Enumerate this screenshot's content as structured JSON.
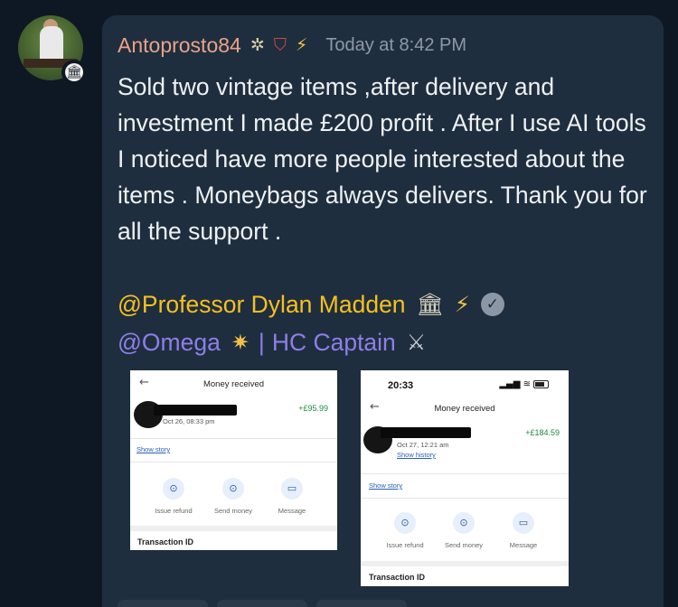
{
  "post": {
    "username": "Antoprosto84",
    "timestamp": "Today at 8:42 PM",
    "badges": [
      "pin-icon",
      "shield-icon",
      "lightning-icon"
    ],
    "message": "Sold two vintage items ,after delivery and investment I made £200 profit . After I use AI tools I noticed have more people interested about the items . Moneybags always delivers. Thank you for all the support .",
    "mentions": [
      {
        "text": "@Professor Dylan Madden",
        "icons": [
          "bank-icon",
          "lightning-icon",
          "verified-icon"
        ]
      },
      {
        "text": "@Omega",
        "icons": [
          "comet-icon"
        ],
        "suffix": "HC Captain",
        "suffix_icon": "swords-icon"
      }
    ]
  },
  "colors": {
    "background": "#0e1824",
    "bubble": "#1f2e3e",
    "username": "#e8a38a",
    "mention_gold": "#f5c022",
    "mention_purple": "#8d7fe8",
    "amount_green": "#1d8a3d"
  },
  "attachments": [
    {
      "title": "Money received",
      "amount": "+£95.99",
      "date": "Oct 26, 08:33 pm",
      "story_link": "Show story",
      "actions": [
        "Issue refund",
        "Send money",
        "Message"
      ],
      "transaction_label": "Transaction ID"
    },
    {
      "status_time": "20:33",
      "title": "Money received",
      "amount": "+£184.59",
      "date": "Oct 27, 12:21 am",
      "history_link": "Show history",
      "story_link": "Show story",
      "actions": [
        "Issue refund",
        "Send money",
        "Message"
      ],
      "transaction_label": "Transaction ID"
    }
  ]
}
